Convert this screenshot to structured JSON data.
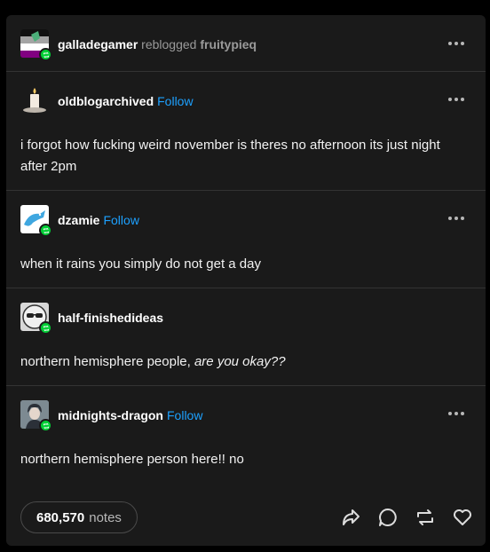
{
  "header": {
    "reblogger": "galladegamer",
    "reblogged_word": "reblogged",
    "source": "fruitypieq"
  },
  "thread": [
    {
      "username": "oldblogarchived",
      "follow_label": "Follow",
      "avatar_icon": "candle-icon",
      "body": "i forgot how fucking weird november is theres no afternoon its just night after 2pm"
    },
    {
      "username": "dzamie",
      "follow_label": "Follow",
      "avatar_icon": "blue-dragon-icon",
      "body": "when it rains you simply do not get a day"
    },
    {
      "username": "half-finishedideas",
      "avatar_icon": "sunglasses-icon",
      "body_plain": "northern hemisphere people, ",
      "body_italic": "are you okay??"
    },
    {
      "username": "midnights-dragon",
      "follow_label": "Follow",
      "avatar_icon": "character-portrait-icon",
      "body": "northern hemisphere person here!! no"
    }
  ],
  "footer": {
    "notes_count": "680,570",
    "notes_label": "notes",
    "actions": [
      "share-icon",
      "reply-icon",
      "reblog-icon",
      "like-icon"
    ]
  },
  "colors": {
    "background": "#000000",
    "card": "#1a1a1a",
    "follow_link": "#1da1ff",
    "reblog_badge": "#00cf35"
  }
}
